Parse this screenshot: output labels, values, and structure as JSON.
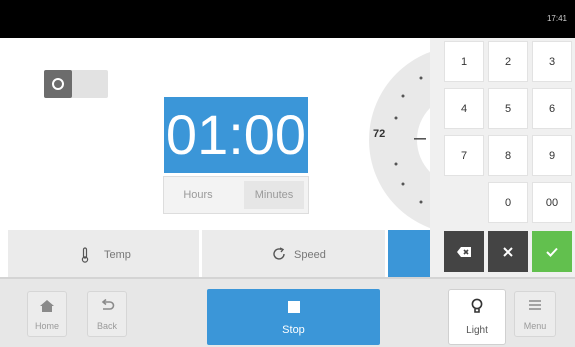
{
  "status_bar": {
    "time": "17:41"
  },
  "timer": {
    "display": "01:00",
    "units": {
      "hours": "Hours",
      "minutes": "Minutes"
    },
    "selected_unit": "Minutes"
  },
  "dial": {
    "value": "72",
    "minus_symbol": "–"
  },
  "numpad": {
    "keys": [
      "1",
      "2",
      "3",
      "4",
      "5",
      "6",
      "7",
      "8",
      "9",
      "0",
      "00"
    ]
  },
  "features": {
    "temp_label": "Temp",
    "speed_label": "Speed"
  },
  "nav": {
    "home_label": "Home",
    "back_label": "Back",
    "stop_label": "Stop",
    "light_label": "Light",
    "menu_label": "Menu"
  },
  "colors": {
    "accent": "#3b96d8",
    "confirm": "#62c04e",
    "dark_key": "#444444"
  },
  "icons": [
    "power-icon",
    "thermometer-icon",
    "rotate-icon",
    "backspace-icon",
    "clear-icon",
    "checkmark-icon",
    "home-icon",
    "back-arrow-icon",
    "stop-icon",
    "lightbulb-icon",
    "menu-icon"
  ]
}
